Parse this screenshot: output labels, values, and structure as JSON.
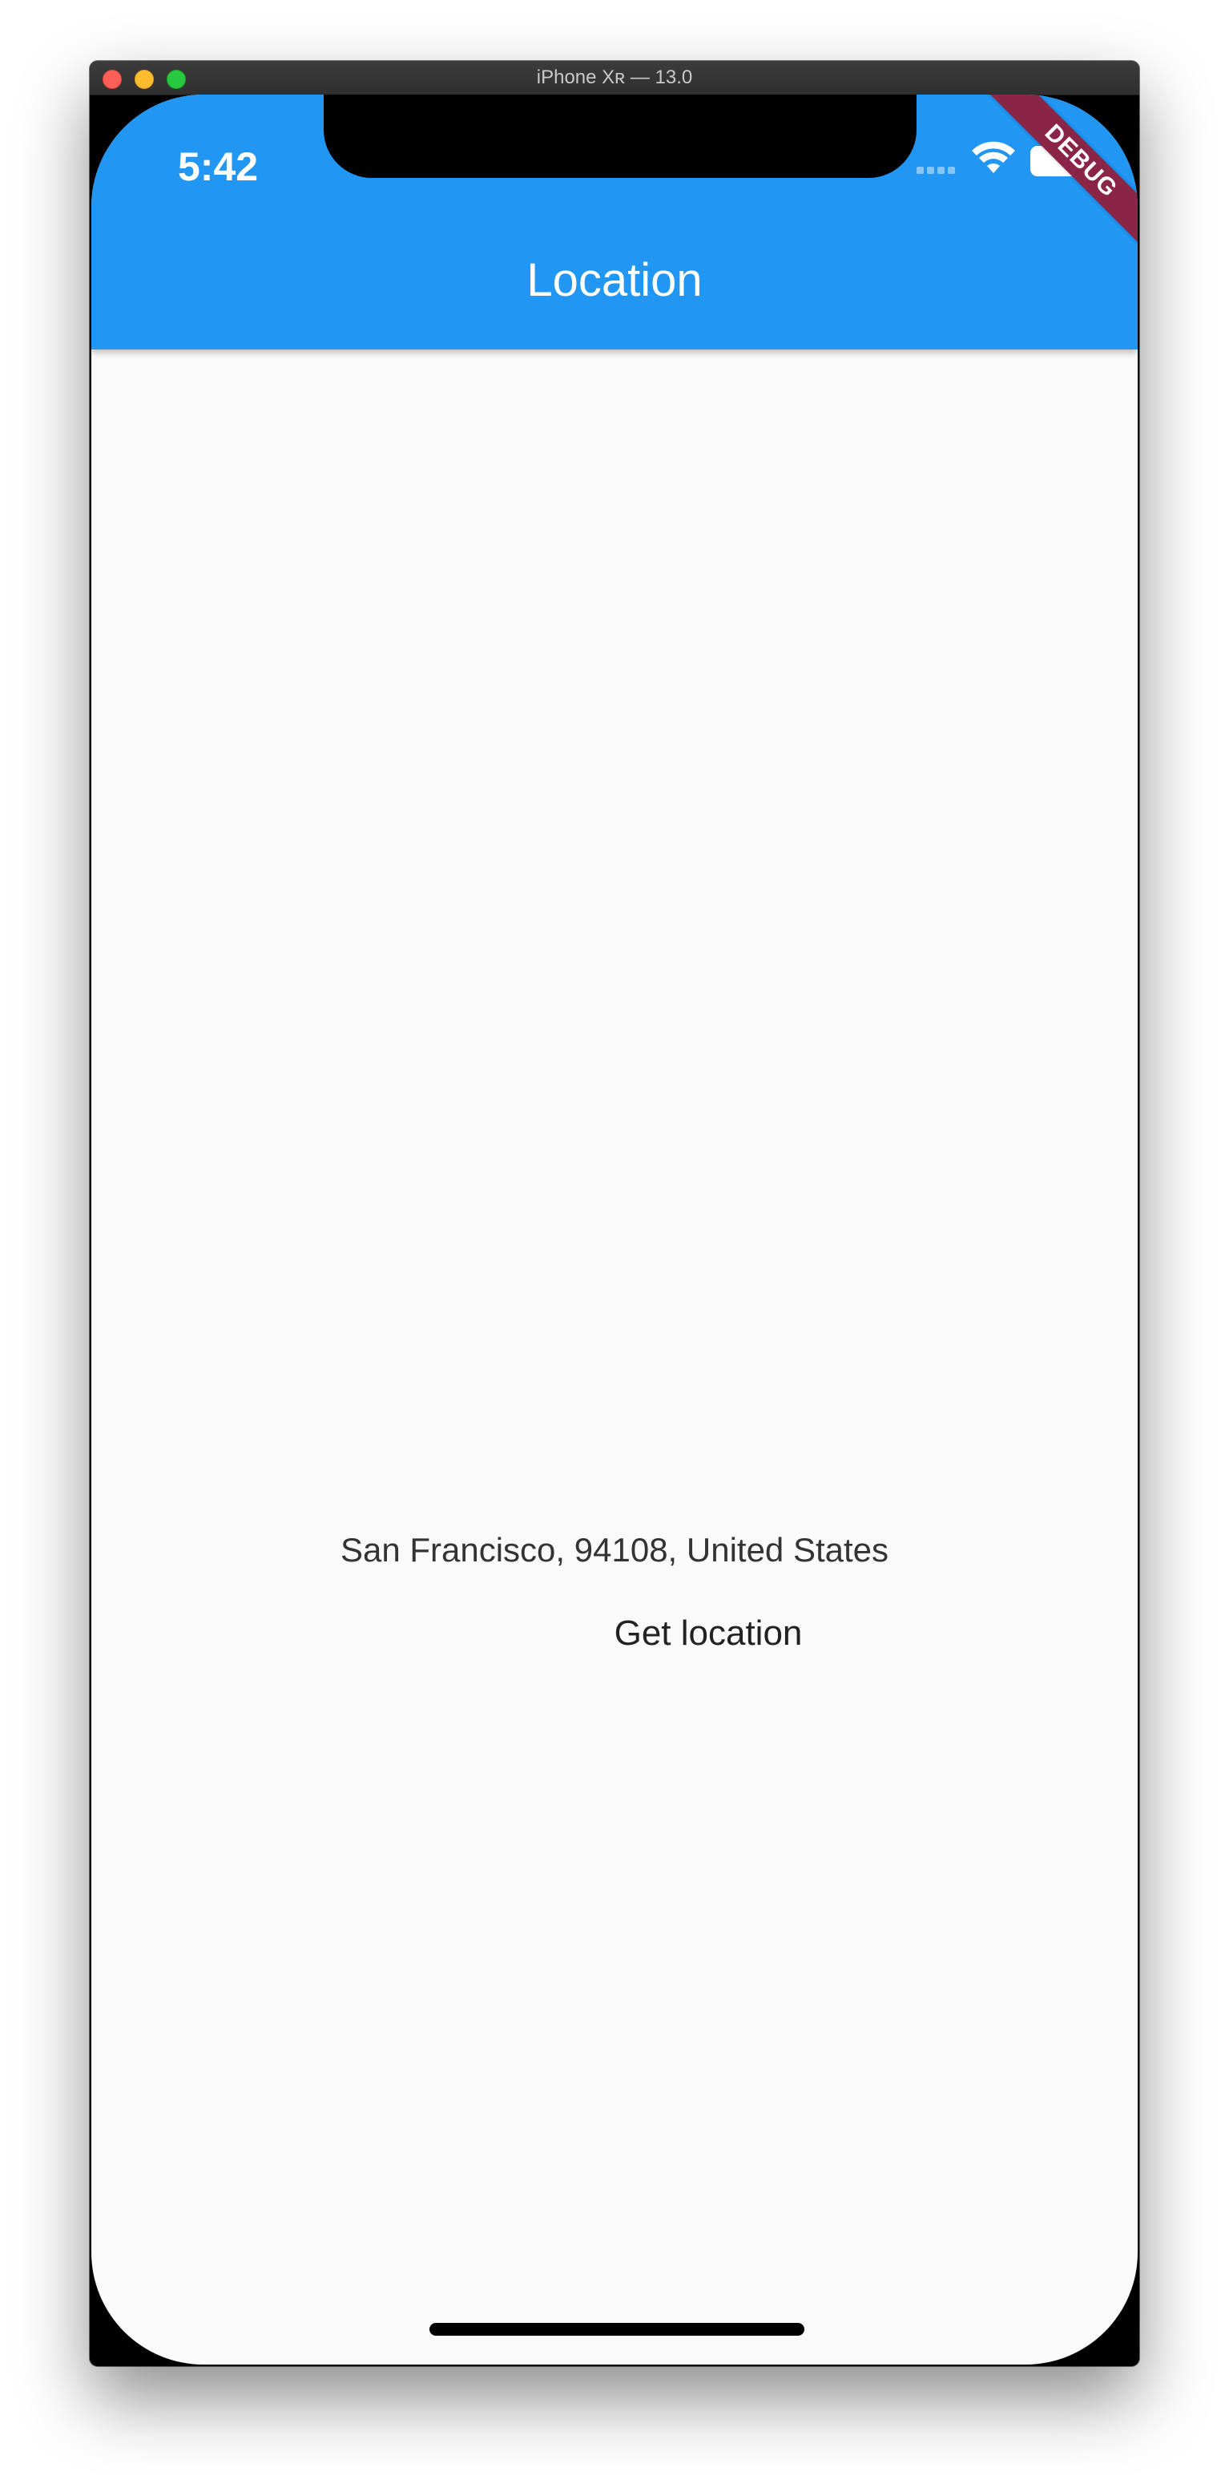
{
  "window": {
    "title": "iPhone Xʀ — 13.0"
  },
  "status_bar": {
    "time": "5:42",
    "wifi_icon": "wifi-icon",
    "battery_icon": "battery-icon",
    "signal_icon": "cellular-signal-icon"
  },
  "app_bar": {
    "title": "Location",
    "color": "#2196f3"
  },
  "debug_banner": {
    "label": "DEBUG",
    "color": "#8b2547"
  },
  "main": {
    "address": "San Francisco, 94108, United States",
    "button_label": "Get location"
  }
}
